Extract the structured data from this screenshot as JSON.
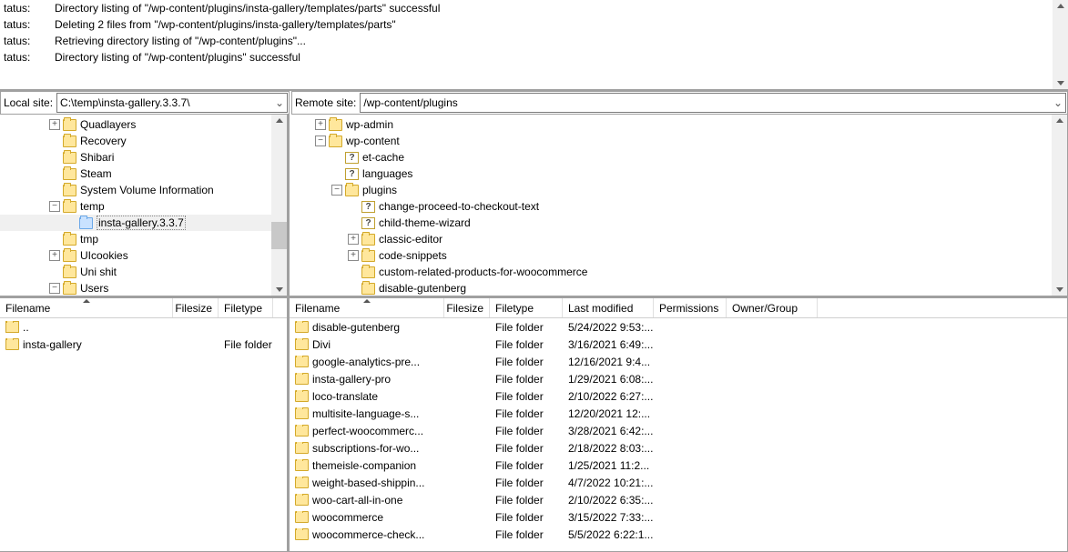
{
  "status": {
    "label": "tatus:",
    "lines": [
      "Directory listing of \"/wp-content/plugins/insta-gallery/templates/parts\" successful",
      "Deleting 2 files from \"/wp-content/plugins/insta-gallery/templates/parts\"",
      "Retrieving directory listing of \"/wp-content/plugins\"...",
      "Directory listing of \"/wp-content/plugins\" successful"
    ]
  },
  "local": {
    "label": "Local site:",
    "path": "C:\\temp\\insta-gallery.3.3.7\\",
    "tree": [
      {
        "indent": 54,
        "exp": "plus",
        "icon": "folder",
        "label": "Quadlayers"
      },
      {
        "indent": 54,
        "exp": "none",
        "icon": "folder",
        "label": "Recovery"
      },
      {
        "indent": 54,
        "exp": "none",
        "icon": "folder",
        "label": "Shibari"
      },
      {
        "indent": 54,
        "exp": "none",
        "icon": "folder",
        "label": "Steam"
      },
      {
        "indent": 54,
        "exp": "none",
        "icon": "folder",
        "label": "System Volume Information"
      },
      {
        "indent": 54,
        "exp": "minus",
        "icon": "folder",
        "label": "temp"
      },
      {
        "indent": 72,
        "exp": "none",
        "icon": "folder",
        "label": "insta-gallery.3.3.7",
        "selected": true
      },
      {
        "indent": 54,
        "exp": "none",
        "icon": "folder",
        "label": "tmp"
      },
      {
        "indent": 54,
        "exp": "plus",
        "icon": "folder",
        "label": "UIcookies"
      },
      {
        "indent": 54,
        "exp": "none",
        "icon": "folder",
        "label": "Uni shit"
      },
      {
        "indent": 54,
        "exp": "minus",
        "icon": "folder",
        "label": "Users"
      }
    ],
    "headers": {
      "filename": "Filename",
      "filesize": "Filesize",
      "filetype": "Filetype"
    },
    "rows": [
      {
        "name": "..",
        "size": "",
        "type": "",
        "up": true
      },
      {
        "name": "insta-gallery",
        "size": "",
        "type": "File folder"
      }
    ]
  },
  "remote": {
    "label": "Remote site:",
    "path": "/wp-content/plugins",
    "tree": [
      {
        "indent": 28,
        "exp": "plus",
        "icon": "folder",
        "label": "wp-admin"
      },
      {
        "indent": 28,
        "exp": "minus",
        "icon": "folder",
        "label": "wp-content"
      },
      {
        "indent": 46,
        "exp": "none",
        "icon": "q",
        "label": "et-cache"
      },
      {
        "indent": 46,
        "exp": "none",
        "icon": "q",
        "label": "languages"
      },
      {
        "indent": 46,
        "exp": "minus",
        "icon": "folder",
        "label": "plugins"
      },
      {
        "indent": 64,
        "exp": "none",
        "icon": "q",
        "label": "change-proceed-to-checkout-text"
      },
      {
        "indent": 64,
        "exp": "none",
        "icon": "q",
        "label": "child-theme-wizard"
      },
      {
        "indent": 64,
        "exp": "plus",
        "icon": "folder",
        "label": "classic-editor"
      },
      {
        "indent": 64,
        "exp": "plus",
        "icon": "folder",
        "label": "code-snippets"
      },
      {
        "indent": 64,
        "exp": "none",
        "icon": "folder",
        "label": "custom-related-products-for-woocommerce"
      },
      {
        "indent": 64,
        "exp": "none",
        "icon": "folder",
        "label": "disable-gutenberg"
      }
    ],
    "headers": {
      "filename": "Filename",
      "filesize": "Filesize",
      "filetype": "Filetype",
      "lastmod": "Last modified",
      "perms": "Permissions",
      "owner": "Owner/Group"
    },
    "rows": [
      {
        "name": "disable-gutenberg",
        "size": "",
        "type": "File folder",
        "lm": "5/24/2022 9:53:...",
        "pm": "",
        "og": ""
      },
      {
        "name": "Divi",
        "size": "",
        "type": "File folder",
        "lm": "3/16/2021 6:49:...",
        "pm": "",
        "og": ""
      },
      {
        "name": "google-analytics-pre...",
        "size": "",
        "type": "File folder",
        "lm": "12/16/2021 9:4...",
        "pm": "",
        "og": ""
      },
      {
        "name": "insta-gallery-pro",
        "size": "",
        "type": "File folder",
        "lm": "1/29/2021 6:08:...",
        "pm": "",
        "og": ""
      },
      {
        "name": "loco-translate",
        "size": "",
        "type": "File folder",
        "lm": "2/10/2022 6:27:...",
        "pm": "",
        "og": ""
      },
      {
        "name": "multisite-language-s...",
        "size": "",
        "type": "File folder",
        "lm": "12/20/2021 12:...",
        "pm": "",
        "og": ""
      },
      {
        "name": "perfect-woocommerc...",
        "size": "",
        "type": "File folder",
        "lm": "3/28/2021 6:42:...",
        "pm": "",
        "og": ""
      },
      {
        "name": "subscriptions-for-wo...",
        "size": "",
        "type": "File folder",
        "lm": "2/18/2022 8:03:...",
        "pm": "",
        "og": ""
      },
      {
        "name": "themeisle-companion",
        "size": "",
        "type": "File folder",
        "lm": "1/25/2021 11:2...",
        "pm": "",
        "og": ""
      },
      {
        "name": "weight-based-shippin...",
        "size": "",
        "type": "File folder",
        "lm": "4/7/2022 10:21:...",
        "pm": "",
        "og": ""
      },
      {
        "name": "woo-cart-all-in-one",
        "size": "",
        "type": "File folder",
        "lm": "2/10/2022 6:35:...",
        "pm": "",
        "og": ""
      },
      {
        "name": "woocommerce",
        "size": "",
        "type": "File folder",
        "lm": "3/15/2022 7:33:...",
        "pm": "",
        "og": ""
      },
      {
        "name": "woocommerce-check...",
        "size": "",
        "type": "File folder",
        "lm": "5/5/2022 6:22:1...",
        "pm": "",
        "og": ""
      }
    ]
  }
}
